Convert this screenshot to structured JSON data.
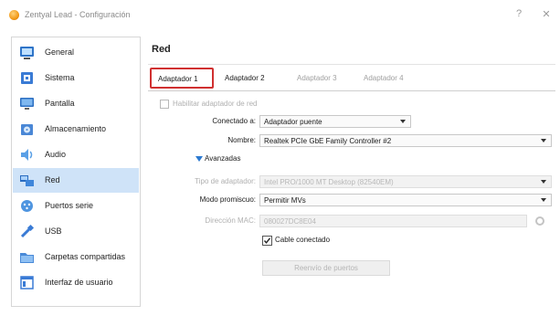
{
  "window": {
    "title": "Zentyal Lead - Configuración",
    "help_glyph": "?",
    "close_glyph": "✕"
  },
  "sidebar": {
    "items": [
      {
        "label": "General",
        "icon": "general-icon"
      },
      {
        "label": "Sistema",
        "icon": "system-icon"
      },
      {
        "label": "Pantalla",
        "icon": "display-icon"
      },
      {
        "label": "Almacenamiento",
        "icon": "storage-icon"
      },
      {
        "label": "Audio",
        "icon": "audio-icon"
      },
      {
        "label": "Red",
        "icon": "network-icon",
        "selected": true
      },
      {
        "label": "Puertos serie",
        "icon": "serial-ports-icon"
      },
      {
        "label": "USB",
        "icon": "usb-icon"
      },
      {
        "label": "Carpetas compartidas",
        "icon": "shared-folders-icon"
      },
      {
        "label": "Interfaz de usuario",
        "icon": "user-interface-icon"
      }
    ]
  },
  "main": {
    "section_title": "Red",
    "tabs": [
      {
        "label": "Adaptador 1",
        "active": true
      },
      {
        "label": "Adaptador 2",
        "active": false
      },
      {
        "label": "Adaptador 3",
        "active": false
      },
      {
        "label": "Adaptador 4",
        "active": false
      }
    ],
    "enable_adapter": {
      "label": "Habilitar adaptador de red",
      "checked": true
    },
    "attached_to": {
      "label": "Conectado a:",
      "value": "Adaptador puente"
    },
    "name": {
      "label": "Nombre:",
      "value": "Realtek PCIe GbE Family Controller #2"
    },
    "advanced": {
      "label": "Avanzadas"
    },
    "adapter_type": {
      "label": "Tipo de adaptador:",
      "value": "Intel PRO/1000 MT Desktop (82540EM)"
    },
    "promiscuous": {
      "label": "Modo promiscuo:",
      "value": "Permitir MVs"
    },
    "mac": {
      "label": "Dirección MAC:",
      "value": "080027DC8E04"
    },
    "cable": {
      "label": "Cable conectado",
      "checked": true
    },
    "port_forwarding": {
      "label": "Reenvío de puertos"
    }
  },
  "colors": {
    "selection": "#cfe3f8",
    "highlight_border": "#d03030",
    "accent": "#2b79d0"
  }
}
